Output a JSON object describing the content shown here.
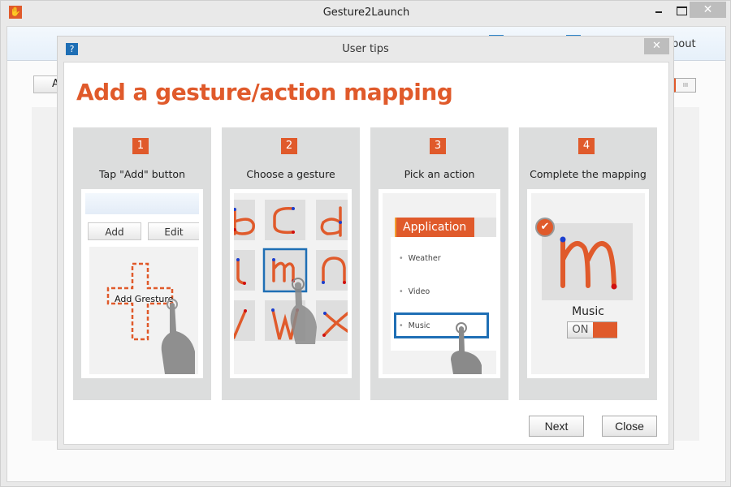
{
  "window": {
    "title": "Gesture2Launch",
    "app_icon": "gesture-hand-icon",
    "close_glyph": "✕",
    "toolbar_about_partial": "bout",
    "background_add_partial": "A",
    "background_toggle_glyph": "III"
  },
  "dialog": {
    "title": "User tips",
    "help_glyph": "?",
    "close_glyph": "✕",
    "heading": "Add a gesture/action mapping",
    "steps": [
      {
        "number": "1",
        "label": "Tap \"Add\" button"
      },
      {
        "number": "2",
        "label": "Choose a gesture"
      },
      {
        "number": "3",
        "label": "Pick an action"
      },
      {
        "number": "4",
        "label": "Complete the mapping"
      }
    ],
    "step1": {
      "add_button": "Add",
      "edit_button": "Edit",
      "add_gesture_label": "Add Gresture"
    },
    "step2": {
      "gestures": [
        "b",
        "c",
        "d",
        "l",
        "m",
        "n",
        "v",
        "w",
        "x"
      ],
      "selected": "m"
    },
    "step3": {
      "tab": "Application",
      "items": [
        "Weather",
        "Video",
        "Music"
      ],
      "selected": "Music"
    },
    "step4": {
      "gesture": "m",
      "action": "Music",
      "toggle_label": "ON",
      "toggle_state": "on",
      "check_glyph": "✔"
    },
    "next_button": "Next",
    "close_button": "Close"
  },
  "colors": {
    "accent": "#e05a2b",
    "selection": "#1f6fb5",
    "stroke_start": "#1c3fcf",
    "stroke_end": "#d01010"
  }
}
